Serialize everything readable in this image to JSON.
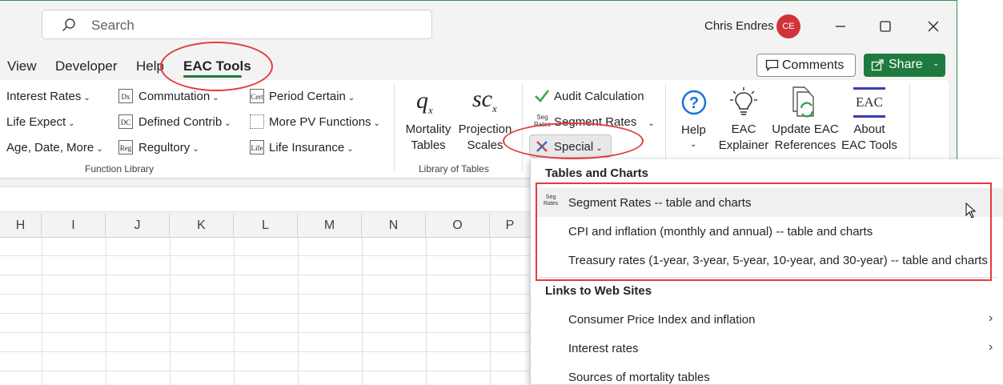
{
  "titlebar": {
    "search_placeholder": "Search",
    "user_name": "Chris Endres",
    "user_initials": "CE"
  },
  "tabs": [
    {
      "label": "View"
    },
    {
      "label": "Developer"
    },
    {
      "label": "Help"
    },
    {
      "label": "EAC Tools",
      "selected": true
    }
  ],
  "actions": {
    "comments": "Comments",
    "share": "Share"
  },
  "function_library": {
    "label": "Function Library",
    "col1": [
      "Interest Rates",
      "Life Expect",
      "Age, Date, More"
    ],
    "col2": [
      "Commutation",
      "Defined Contrib",
      "Regultory"
    ],
    "col3": [
      "Period Certain",
      "More PV Functions",
      "Life Insurance"
    ],
    "icons": {
      "commutation": "Dx",
      "defined": "DC",
      "reg": "Reg",
      "cert": "Cert",
      "life": "Life"
    }
  },
  "library_of_tables": {
    "label": "Library of Tables",
    "mortality": [
      "Mortality",
      "Tables"
    ],
    "projection": [
      "Projection",
      "Scales"
    ],
    "q_symbol": "q",
    "q_sub": "x",
    "sc_symbol": "sc",
    "sc_sub": "x"
  },
  "calc_group": {
    "audit": "Audit Calculation",
    "segment": "Segment Rates",
    "special": "Special",
    "seg_icon_top": "Seg",
    "seg_icon_bottom": "Rates"
  },
  "help_group": {
    "help": "Help",
    "explainer": [
      "EAC",
      "Explainer"
    ],
    "update": [
      "Update EAC",
      "References"
    ],
    "about": [
      "About",
      "EAC Tools"
    ],
    "about_icon": "EAC"
  },
  "columns": [
    "H",
    "I",
    "J",
    "K",
    "L",
    "M",
    "N",
    "O",
    "P"
  ],
  "dropdown": {
    "section1": "Tables and Charts",
    "items1": [
      "Segment Rates -- table and charts",
      "CPI and inflation (monthly and annual) -- table and charts",
      "Treasury rates (1-year, 3-year, 5-year, 10-year, and 30-year) -- table and charts"
    ],
    "section2": "Links to Web Sites",
    "items2": [
      "Consumer Price Index and inflation",
      "Interest rates",
      "Sources of mortality tables"
    ]
  },
  "colors": {
    "accent": "#1e7a3e",
    "annotation": "#e23b3b",
    "avatar": "#d13438"
  }
}
